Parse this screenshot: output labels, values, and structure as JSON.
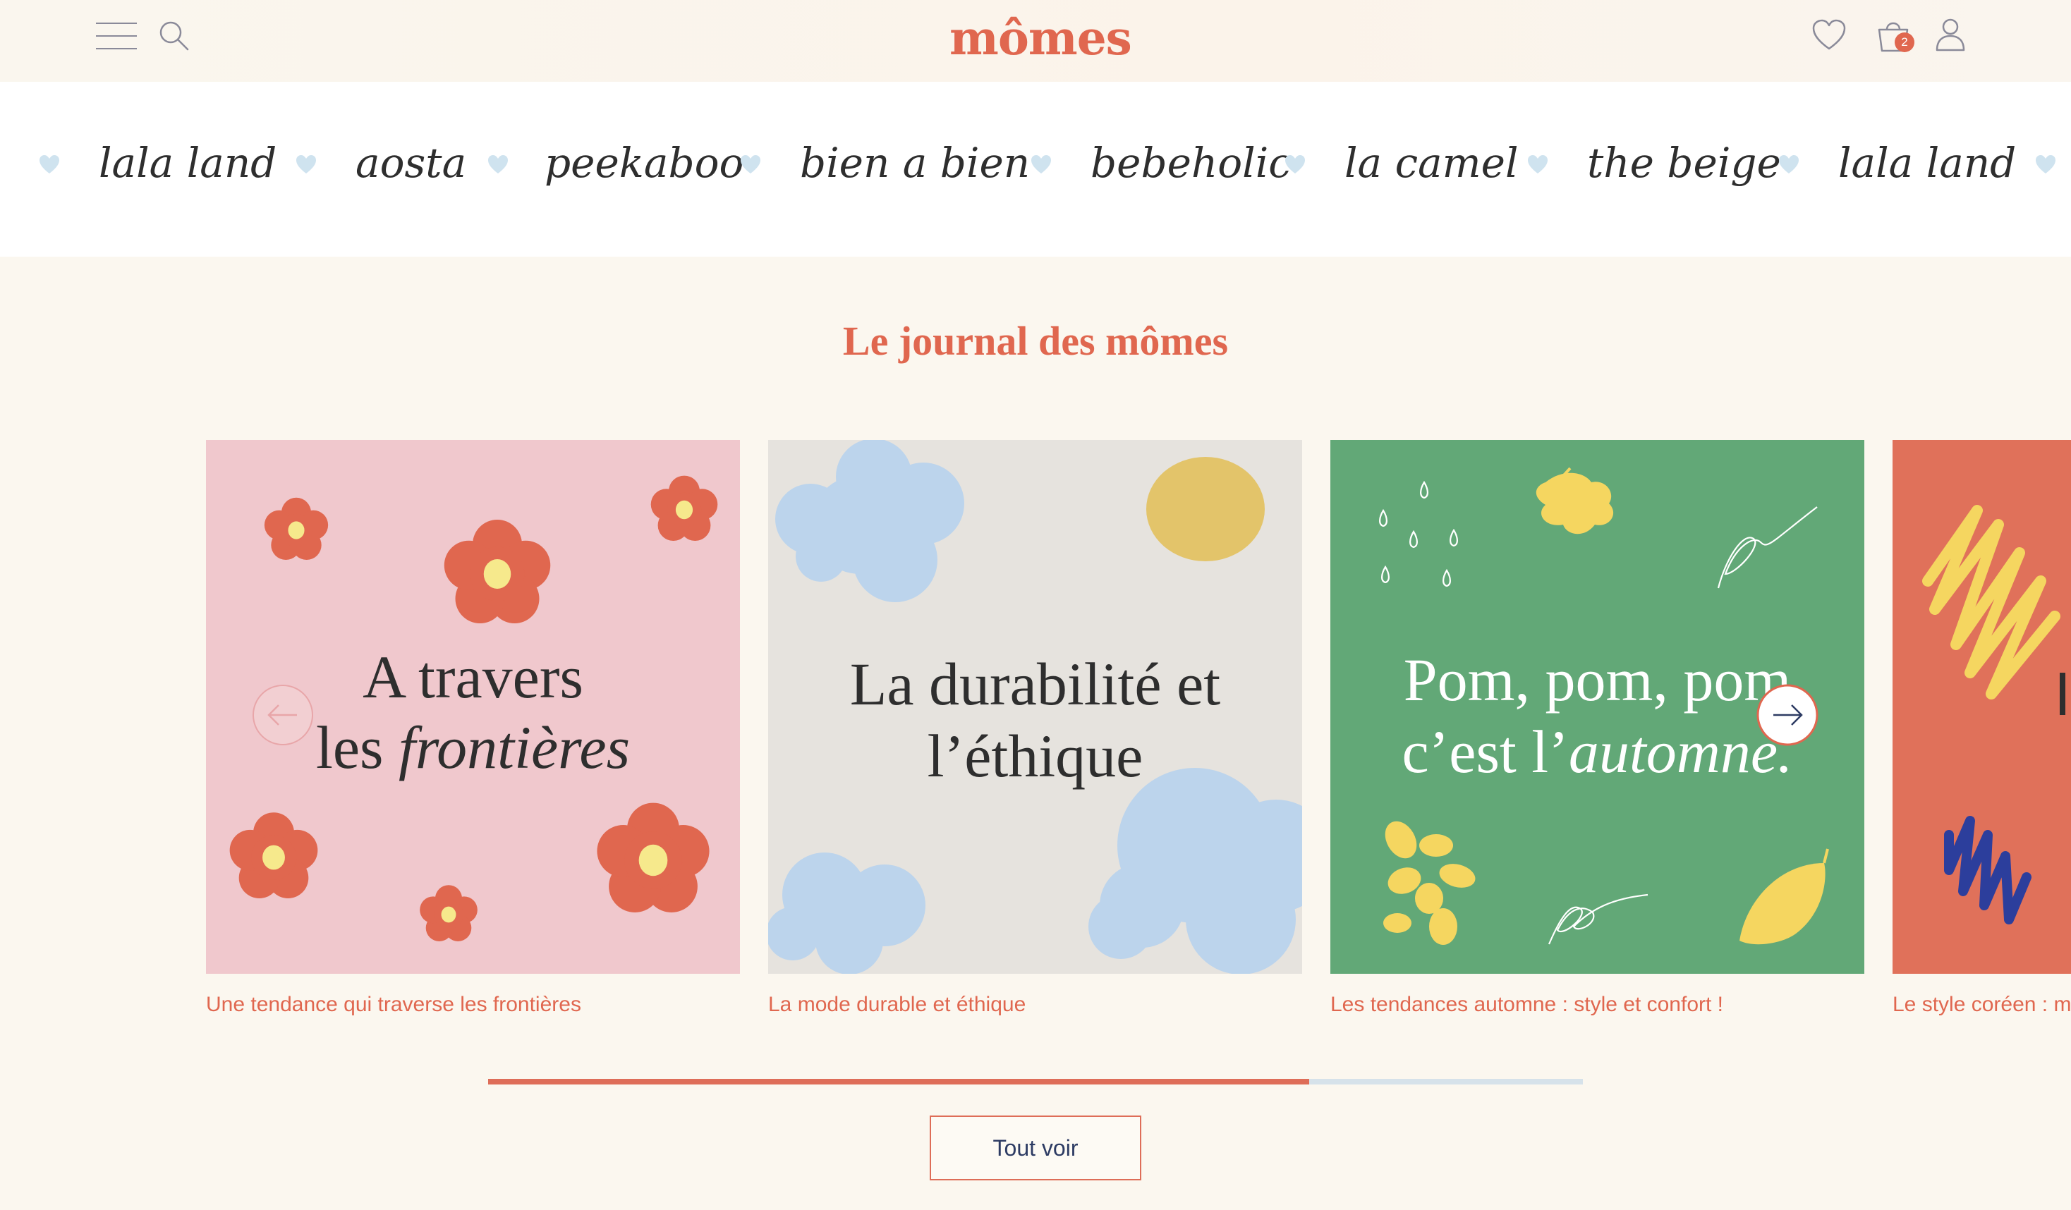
{
  "header": {
    "logo": "mômes",
    "cart_count": "2",
    "icons": [
      "menu-icon",
      "search-icon",
      "heart-icon",
      "cart-icon",
      "user-icon"
    ]
  },
  "brands": {
    "items": [
      "lala land",
      "aosta",
      "peekaboo",
      "bien a bien",
      "bebeholic",
      "la camel",
      "the beige",
      "lala land"
    ],
    "heart_color": "#cfe3ef"
  },
  "journal": {
    "title": "Le journal des mômes",
    "cards": [
      {
        "line1": "A travers",
        "line2_plain": "les ",
        "line2_italic": "frontières",
        "caption": "Une tendance qui traverse les frontières",
        "bg": "#f0c8cd"
      },
      {
        "line1": "La durabilité et",
        "line2_plain": "l’éthique",
        "line2_italic": "",
        "caption": "La mode durable et éthique",
        "bg": "#e6e3de"
      },
      {
        "line1": "Pom, pom, pom",
        "line2_plain": "c’est l’",
        "line2_italic": "automne.",
        "caption": "Les tendances automne : style et confort !",
        "bg": "#62a877"
      },
      {
        "line1": "",
        "line2_plain": "",
        "line2_italic": "",
        "caption": "Le style coréen : m",
        "bg": "#e0715a"
      }
    ],
    "progress": 0.75,
    "see_all": "Tout voir"
  },
  "colors": {
    "accent": "#e0674f",
    "page_bg": "#fbf7ef",
    "navy": "#2d3b63"
  }
}
